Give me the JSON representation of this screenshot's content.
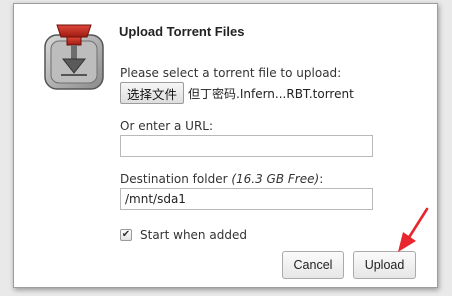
{
  "dialog": {
    "title": "Upload Torrent Files",
    "logo_icon": "transmission-logo-icon"
  },
  "file_section": {
    "label": "Please select a torrent file to upload:",
    "choose_button": "选择文件",
    "chosen_file": "但丁密码.Infern...RBT.torrent"
  },
  "url_section": {
    "label": "Or enter a URL:",
    "value": ""
  },
  "destination": {
    "label": "Destination folder",
    "free_space": "(16.3 GB Free)",
    "label_suffix": ":",
    "value": "/mnt/sda1"
  },
  "start_when_added": {
    "checked": true,
    "label": "Start when added"
  },
  "buttons": {
    "cancel": "Cancel",
    "upload": "Upload"
  },
  "annotation": {
    "arrow_color": "#e8262c",
    "arrow_icon": "red-arrow-icon"
  }
}
